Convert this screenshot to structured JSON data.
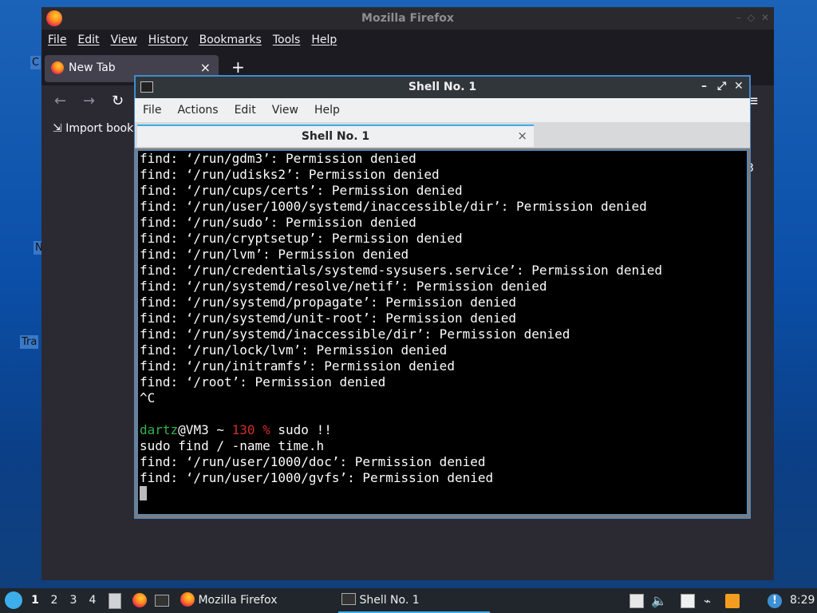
{
  "desktop": {
    "icon_fragments": [
      "C",
      "N",
      "Tra"
    ]
  },
  "firefox": {
    "title": "Mozilla Firefox",
    "menu": [
      "File",
      "Edit",
      "View",
      "History",
      "Bookmarks",
      "Tools",
      "Help"
    ],
    "tab_label": "New Tab",
    "tab_close": "×",
    "new_tab": "+",
    "nav": {
      "back": "←",
      "forward": "→",
      "reload": "↻",
      "menu": "≡"
    },
    "bookmark_label": "Import bookm",
    "edge_digit": "3"
  },
  "terminal": {
    "title": "Shell No. 1",
    "menu": [
      "File",
      "Actions",
      "Edit",
      "View",
      "Help"
    ],
    "tab_label": "Shell No. 1",
    "tab_close": "×",
    "lines": [
      "find: ‘/run/gdm3’: Permission denied",
      "find: ‘/run/udisks2’: Permission denied",
      "find: ‘/run/cups/certs’: Permission denied",
      "find: ‘/run/user/1000/systemd/inaccessible/dir’: Permission denied",
      "find: ‘/run/sudo’: Permission denied",
      "find: ‘/run/cryptsetup’: Permission denied",
      "find: ‘/run/lvm’: Permission denied",
      "find: ‘/run/credentials/systemd-sysusers.service’: Permission denied",
      "find: ‘/run/systemd/resolve/netif’: Permission denied",
      "find: ‘/run/systemd/propagate’: Permission denied",
      "find: ‘/run/systemd/unit-root’: Permission denied",
      "find: ‘/run/systemd/inaccessible/dir’: Permission denied",
      "find: ‘/run/lock/lvm’: Permission denied",
      "find: ‘/run/initramfs’: Permission denied",
      "find: ‘/root’: Permission denied",
      "^C",
      ""
    ],
    "prompt": {
      "user": "dartz",
      "host": "@VM3 ~ ",
      "status": "130 % ",
      "command": "sudo !!"
    },
    "after_lines": [
      "sudo find / -name time.h",
      "find: ‘/run/user/1000/doc’: Permission denied",
      "find: ‘/run/user/1000/gvfs’: Permission denied"
    ]
  },
  "taskbar": {
    "desktops": [
      "1",
      "2",
      "3",
      "4"
    ],
    "tasks": [
      {
        "label": "Mozilla Firefox"
      },
      {
        "label": "Shell No. 1"
      }
    ],
    "clock": "8:29",
    "tray_icons": [
      "clipboard-icon",
      "volume-icon",
      "notes-icon",
      "network-icon",
      "update-icon",
      "notification-icon"
    ]
  },
  "colors": {
    "prompt_user": "#2fb34e",
    "prompt_status": "#d02f2f",
    "accent": "#3daee9"
  }
}
